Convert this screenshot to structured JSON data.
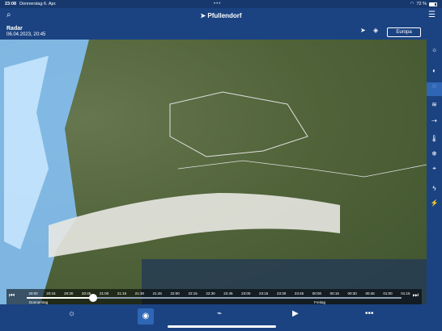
{
  "status": {
    "time": "23:08",
    "date": "Donnerstag 6. Apr.",
    "battery": "72 %",
    "wifi": "wifi-icon"
  },
  "header": {
    "location": "Pfullendorf",
    "search_icon": "search-icon",
    "menu_icon": "menu-icon"
  },
  "radar": {
    "title": "Radar",
    "datetime": "06.04.2023, 20:45",
    "region_button": "Europa",
    "navigation_icon": "navigation-arrow-icon",
    "layers_icon": "layers-icon"
  },
  "timeline": {
    "ticks": [
      "20:00",
      "20:15",
      "20:30",
      "20:45",
      "21:00",
      "21:15",
      "21:30",
      "21:45",
      "22:00",
      "22:15",
      "22:30",
      "22:45",
      "23:00",
      "23:15",
      "23:30",
      "23:45",
      "00:00",
      "00:15",
      "00:30",
      "00:45",
      "01:00",
      "01:15"
    ],
    "day_left": "Donnerstag",
    "day_right": "Freitag",
    "progress": 0.19
  },
  "sidebar": {
    "items": [
      "sun-cloud-icon",
      "weather-icon",
      "radar-icon",
      "wind-icon",
      "thermometer-icon",
      "snow-icon",
      "compass-icon",
      "lightning-icon",
      "bolt-icon"
    ]
  },
  "tabs": {
    "items": [
      "weather-tab",
      "radar-tab",
      "map-tab",
      "play-tab",
      "more-tab"
    ]
  },
  "colors": {
    "header": "#1b4382",
    "accent": "#2f66b5",
    "map": "#506238"
  }
}
